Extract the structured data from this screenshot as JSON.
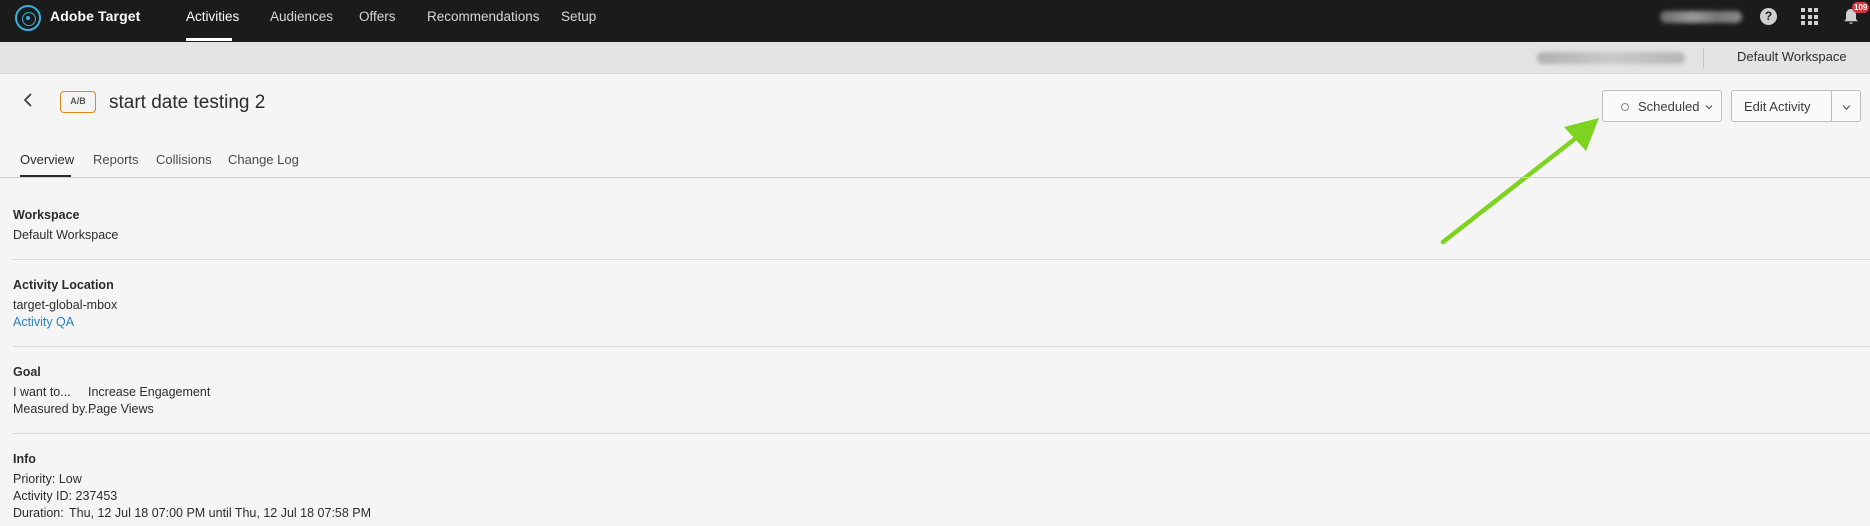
{
  "app": {
    "brand_name": "Adobe Target"
  },
  "topnav": {
    "items": [
      {
        "label": "Activities",
        "active": true
      },
      {
        "label": "Audiences"
      },
      {
        "label": "Offers"
      },
      {
        "label": "Recommendations"
      },
      {
        "label": "Setup"
      }
    ],
    "notifications_count": "109"
  },
  "subbar": {
    "workspace": "Default Workspace"
  },
  "activity": {
    "type_badge": "A/B",
    "title": "start date testing 2",
    "status": "Scheduled",
    "edit_label": "Edit Activity"
  },
  "tabs": [
    {
      "label": "Overview",
      "active": true
    },
    {
      "label": "Reports"
    },
    {
      "label": "Collisions"
    },
    {
      "label": "Change Log"
    }
  ],
  "sections": {
    "workspace": {
      "title": "Workspace",
      "value": "Default Workspace"
    },
    "location": {
      "title": "Activity Location",
      "mbox": "target-global-mbox",
      "qa_link": "Activity QA"
    },
    "goal": {
      "title": "Goal",
      "want_label": "I want to...",
      "want_value": "Increase Engagement",
      "measured_label": "Measured by...",
      "measured_value": "Page Views"
    },
    "info": {
      "title": "Info",
      "priority": "Priority: Low",
      "activity_id": "Activity ID: 237453",
      "duration_label": "Duration:",
      "duration_value": "Thu, 12 Jul 18 07:00 PM until Thu, 12 Jul 18 07:58 PM"
    }
  },
  "colors": {
    "topnav_bg": "#1b1b1b",
    "badge_border": "#e68619",
    "link": "#2d7fc7",
    "annotation_arrow": "#7ed321",
    "notification_badge": "#d7373f"
  }
}
